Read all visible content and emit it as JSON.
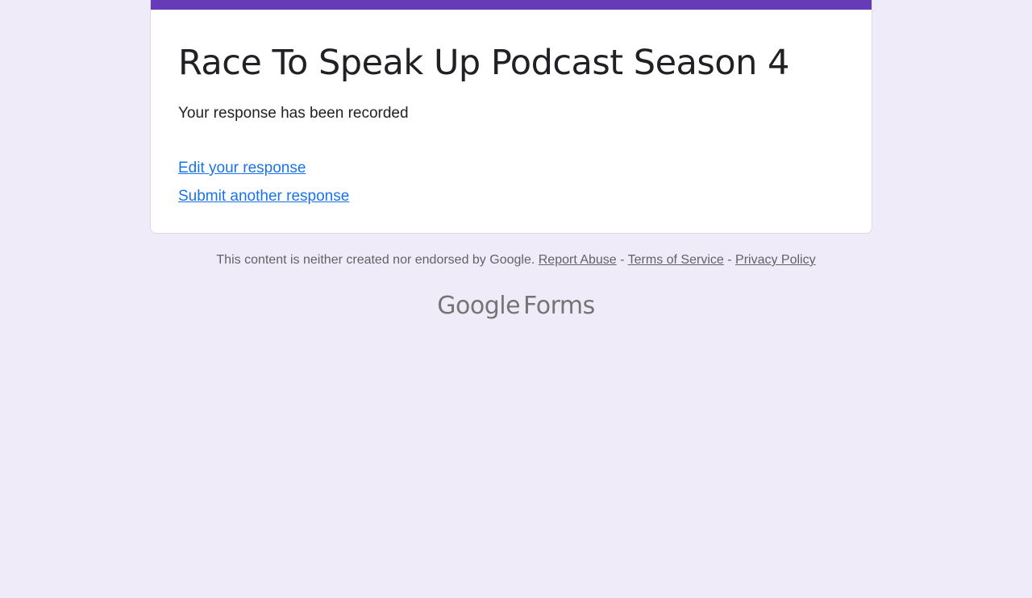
{
  "form": {
    "title": "Race To Speak Up Podcast Season 4",
    "confirmation_message": "Your response has been recorded",
    "links": {
      "edit": "Edit your response",
      "submit_another": "Submit another response"
    },
    "accent_color": "#673ab7",
    "link_color": "#1a73e8",
    "background_color": "#f0ebf8"
  },
  "footer": {
    "disclaimer": "This content is neither created nor endorsed by Google.",
    "separator": "-",
    "report_abuse": "Report Abuse",
    "terms": "Terms of Service",
    "privacy": "Privacy Policy"
  },
  "brand": {
    "google": "Google",
    "product": "Forms"
  }
}
